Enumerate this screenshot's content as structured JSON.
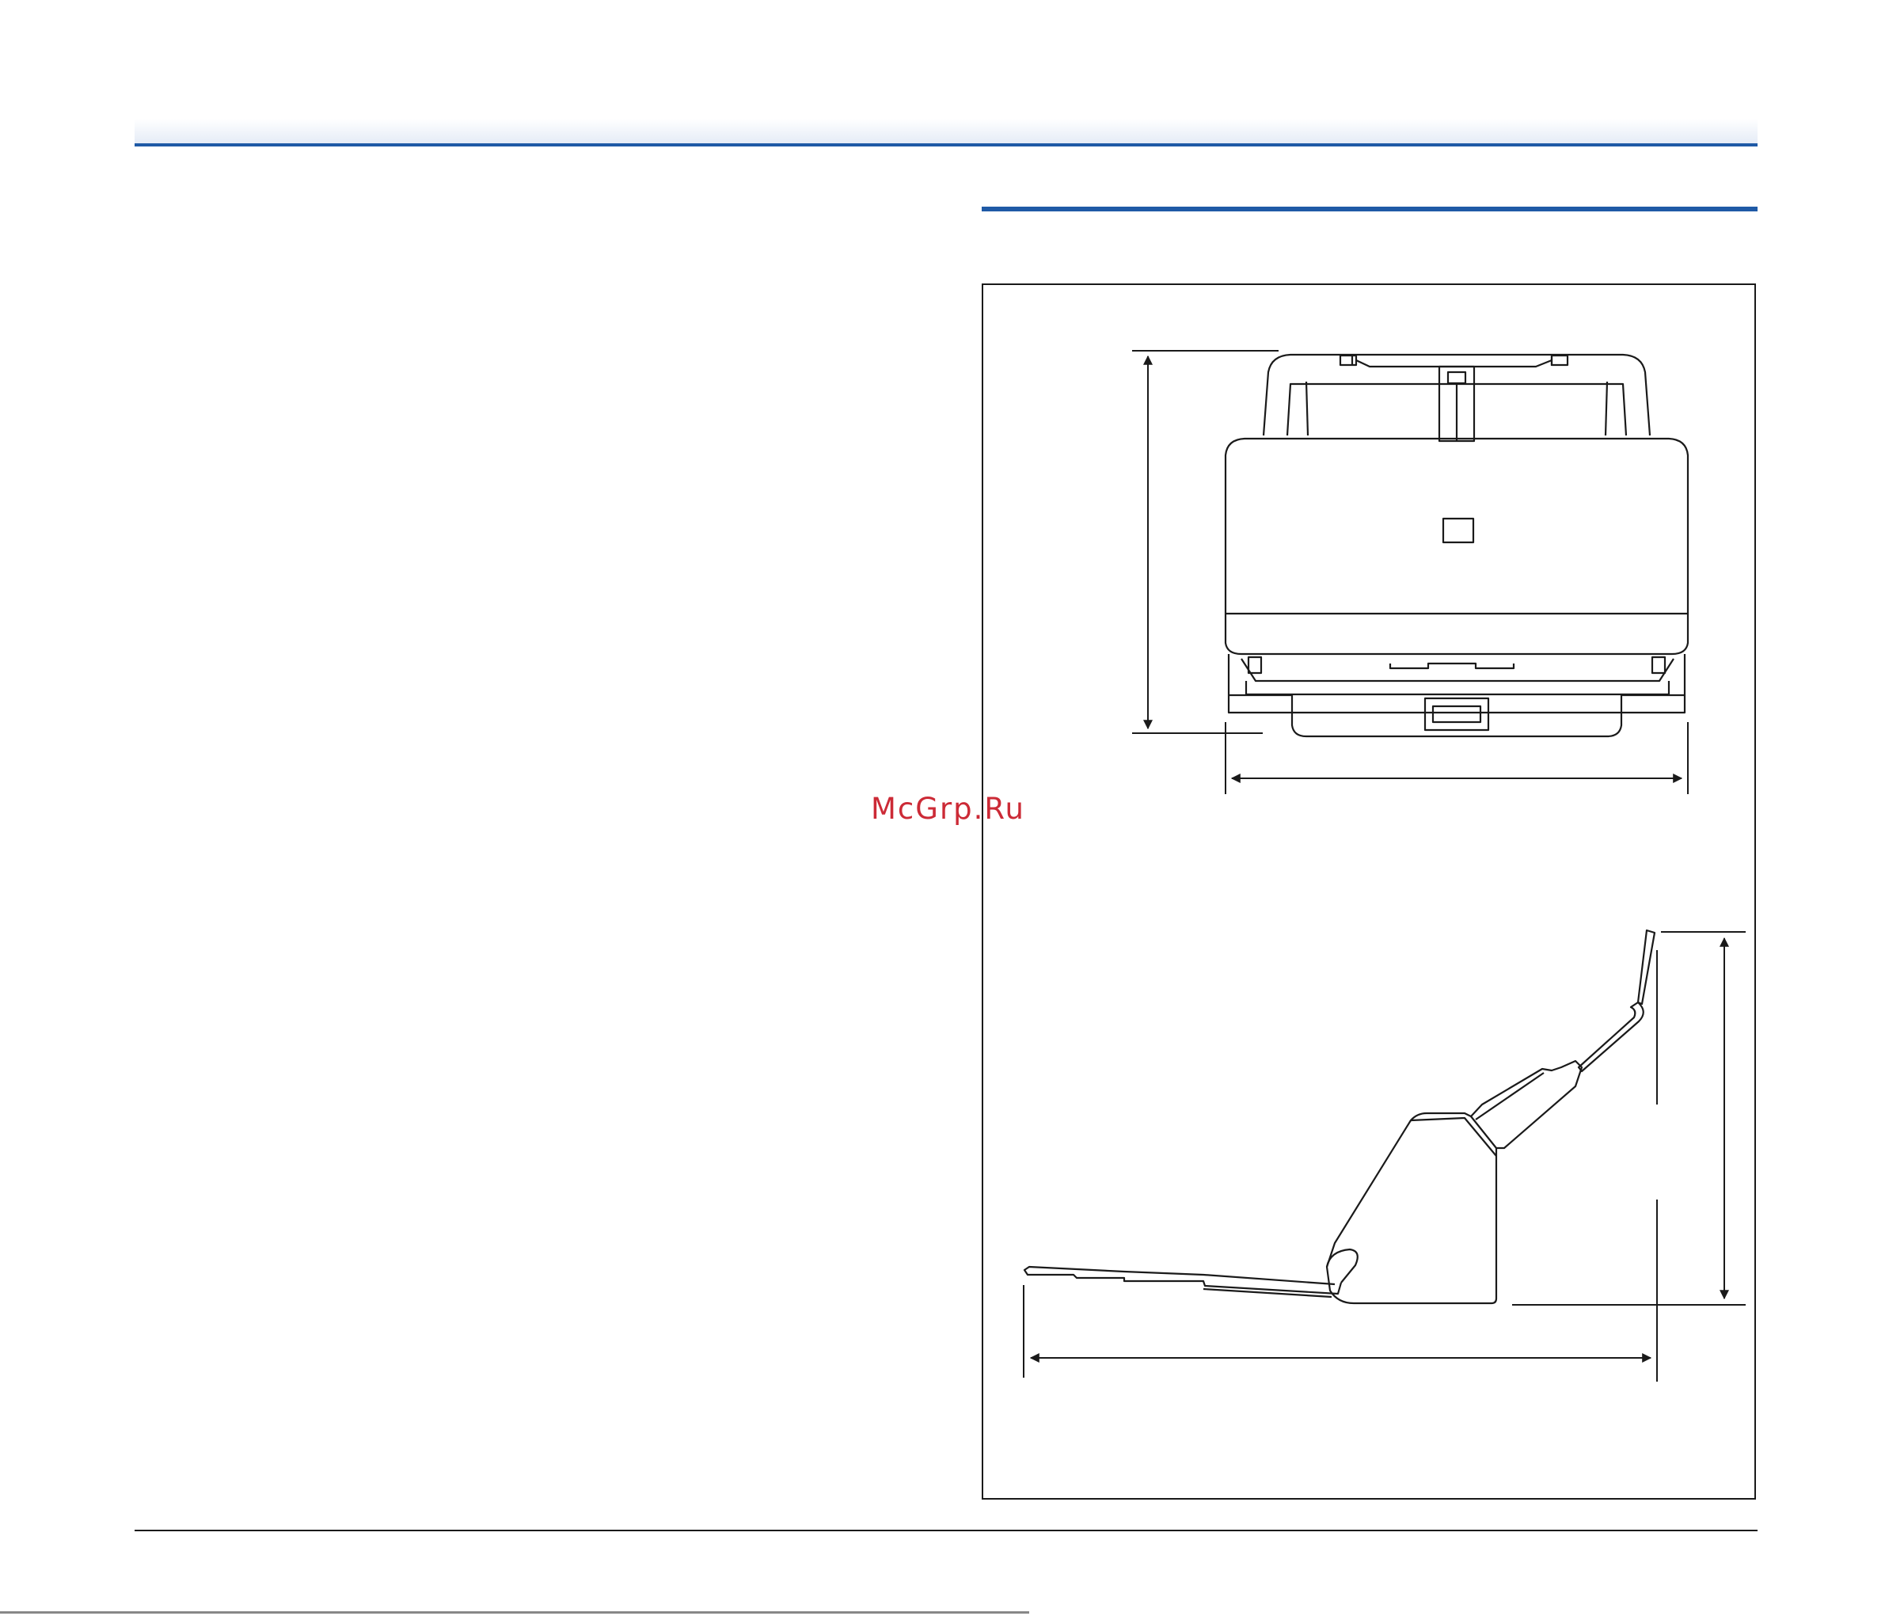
{
  "page": {
    "watermark": "McGrp.Ru"
  },
  "colors": {
    "accent_rule": "#1f5aa6",
    "header_gradient_end": "#e4ebf6",
    "watermark": "#cc2a36",
    "line_art": "#1a1a1a"
  },
  "figure": {
    "views": [
      "front-view",
      "side-view"
    ],
    "dimension_labels_visible": false
  }
}
